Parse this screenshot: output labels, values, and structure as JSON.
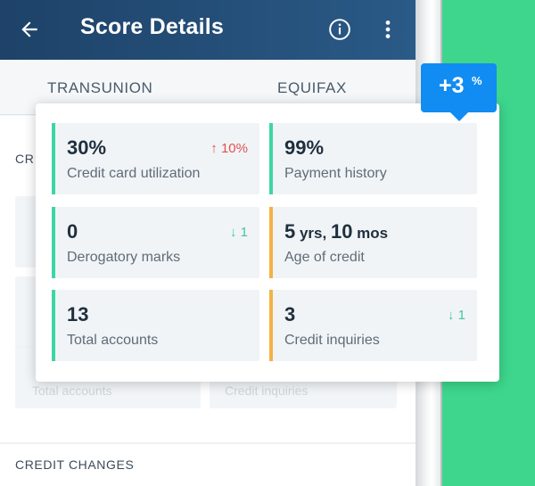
{
  "appbar": {
    "title": "Score Details"
  },
  "tabs": [
    {
      "label": "TRANSUNION"
    },
    {
      "label": "EQUIFAX"
    }
  ],
  "background": {
    "section_stub": "CR",
    "ghost_labels": [
      "Total accounts",
      "Credit inquiries"
    ],
    "credit_changes": "CREDIT CHANGES"
  },
  "badge": {
    "value": "+3",
    "unit": "%"
  },
  "factors": [
    {
      "value": "30%",
      "unit": "",
      "label": "Credit card utilization",
      "delta": "↑ 10%",
      "direction": "up",
      "accent": "#3dd6a3"
    },
    {
      "value": "99%",
      "unit": "",
      "label": "Payment history",
      "delta": "",
      "direction": "",
      "accent": "#3dd6a3"
    },
    {
      "value": "0",
      "unit": "",
      "label": "Derogatory marks",
      "delta": "↓ 1",
      "direction": "down",
      "accent": "#3dd6a3"
    },
    {
      "value": "5",
      "unit": " yrs, ",
      "value2": "10",
      "unit2": " mos",
      "label": "Age of credit",
      "delta": "",
      "direction": "",
      "accent": "#f5b243"
    },
    {
      "value": "13",
      "unit": "",
      "label": "Total accounts",
      "delta": "",
      "direction": "",
      "accent": "#3dd6a3"
    },
    {
      "value": "3",
      "unit": "",
      "label": "Credit inquiries",
      "delta": "↓ 1",
      "direction": "down",
      "accent": "#f5b243"
    }
  ]
}
